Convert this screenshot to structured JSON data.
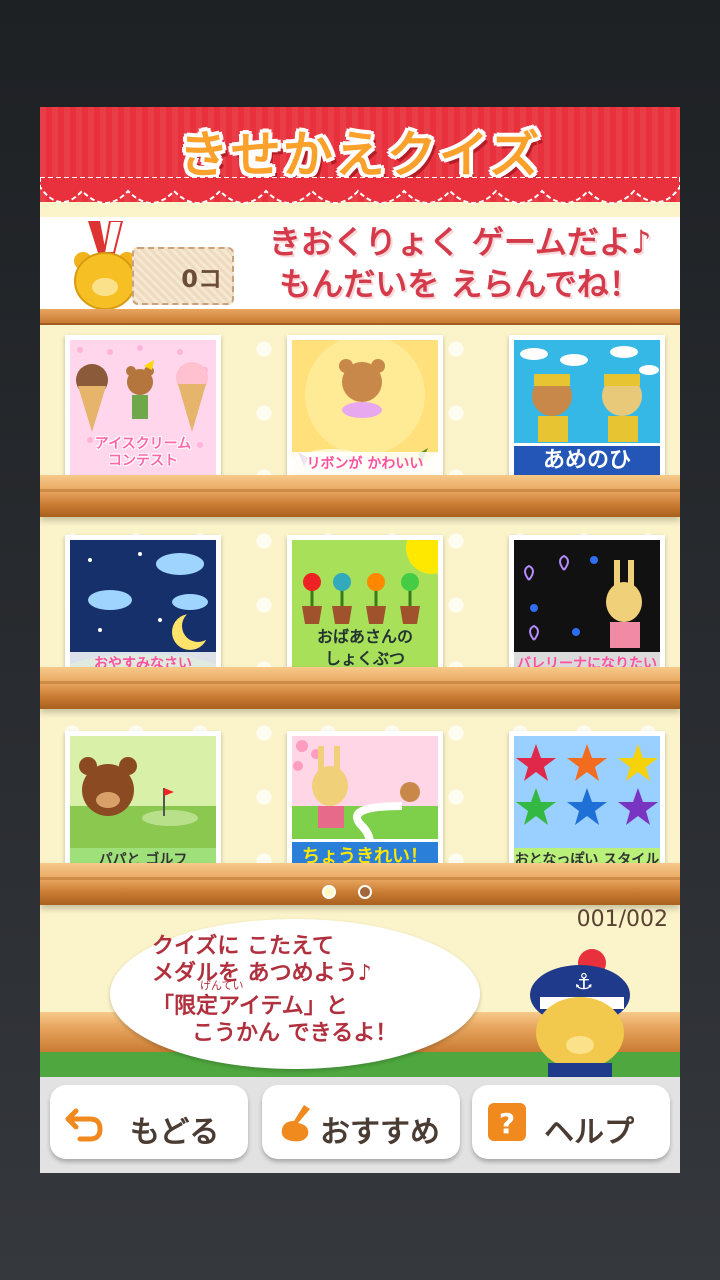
{
  "header": {
    "title": "きせかえクイズ"
  },
  "info": {
    "medal_count": "0コ",
    "message_line1": "きおくりょく ゲームだよ♪",
    "message_line2": "もんだいを えらんでね！"
  },
  "quizzes": [
    {
      "label": "アイスクリーム\nコンテスト"
    },
    {
      "label": "リボンが かわいい"
    },
    {
      "label": "あめのひ"
    },
    {
      "label": "おやすみなさい"
    },
    {
      "label": "おばあさんの\nしょくぶつ"
    },
    {
      "label": "バレリーナになりたい"
    },
    {
      "label": "パパと ゴルフ"
    },
    {
      "label": "ちょうきれい！"
    },
    {
      "label": "おとなっぽい スタイル"
    }
  ],
  "pagination": {
    "page": "001/002",
    "current": 1,
    "total": 2
  },
  "bubble": {
    "line1": "クイズに こたえて",
    "line2": "メダルを あつめよう♪",
    "line3": "「限定アイテム」と",
    "line4": "こうかん できるよ！",
    "ruby": "げんてい"
  },
  "buttons": {
    "back": "もどる",
    "recommend": "おすすめ",
    "help": "ヘルプ"
  },
  "colors": {
    "header_red": "#e8313c",
    "title_orange": "#f9a12b",
    "accent_text": "#d43a4a"
  }
}
